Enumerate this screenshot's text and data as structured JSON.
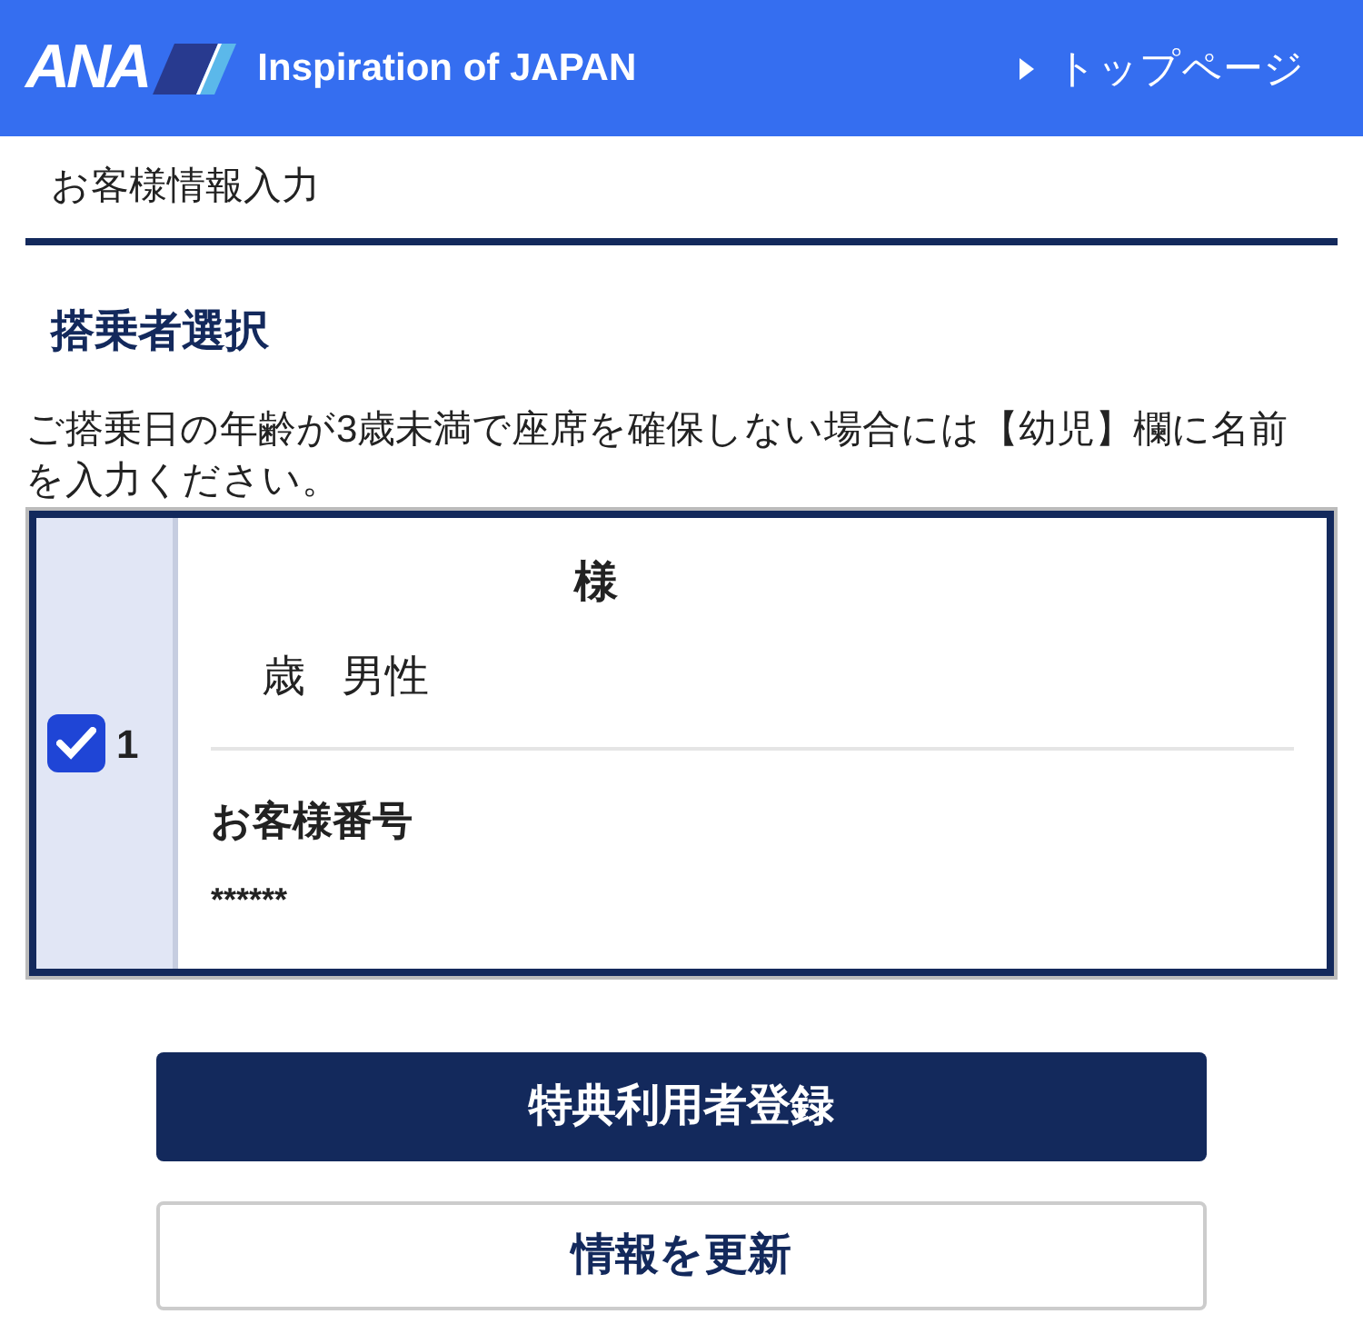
{
  "header": {
    "logo": "ANA",
    "tagline": "Inspiration of JAPAN",
    "top_link": "トップページ"
  },
  "page_title": "お客様情報入力",
  "section_title": "搭乗者選択",
  "notice": "ご搭乗日の年齢が3歳未満で座席を確保しない場合には【幼児】欄に名前を入力ください。",
  "passengers": [
    {
      "checked": true,
      "number": "1",
      "name": "様",
      "age": "歳",
      "gender": "男性",
      "member_label": "お客様番号",
      "member_number": "******"
    }
  ],
  "buttons": [
    {
      "kind": "primary",
      "label": "特典利用者登録"
    },
    {
      "kind": "secondary",
      "label": "情報を更新"
    }
  ]
}
